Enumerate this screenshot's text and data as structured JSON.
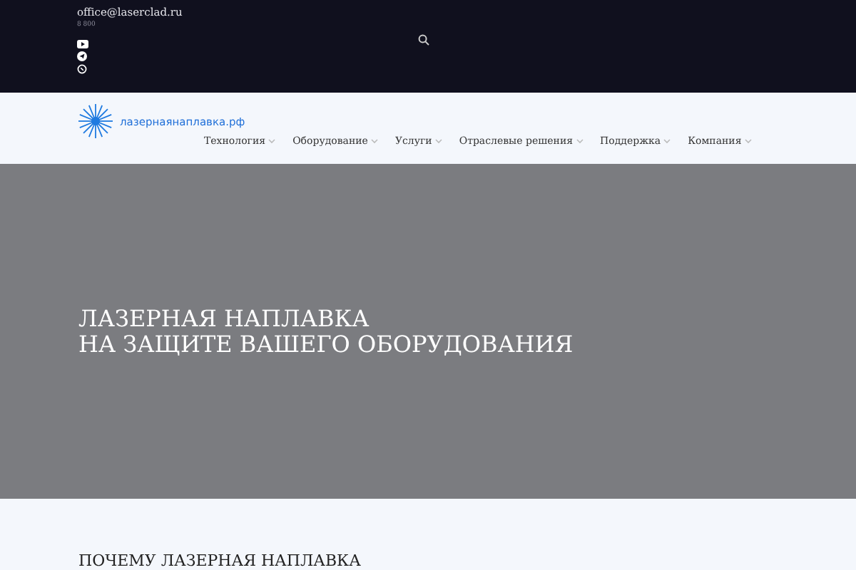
{
  "top_bar": {
    "email": "office@laserclad.ru",
    "phone": "8 800"
  },
  "header": {
    "logo_text": "лазернаянаплавка.рф",
    "nav": [
      {
        "label": "Технология"
      },
      {
        "label": "Оборудование"
      },
      {
        "label": "Услуги"
      },
      {
        "label": "Отраслевые решения"
      },
      {
        "label": "Поддержка"
      },
      {
        "label": "Компания"
      }
    ]
  },
  "hero": {
    "lines": [
      "ЛАЗЕРНАЯ НАПЛАВКА",
      "НА ЗАЩИТЕ ВАШЕГО ОБОРУДОВАНИЯ"
    ]
  },
  "section": {
    "heading": "ПОЧЕМУ ЛАЗЕРНАЯ НАПЛАВКА"
  }
}
